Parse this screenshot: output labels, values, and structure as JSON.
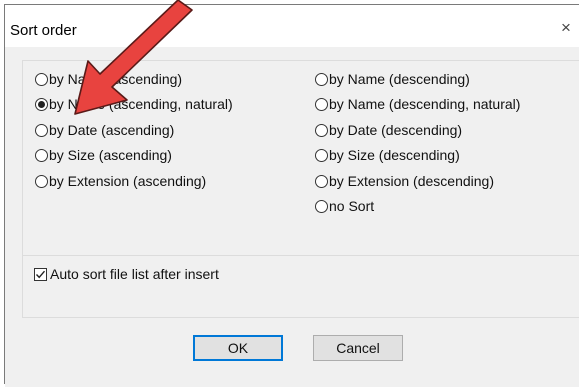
{
  "window": {
    "title": "Sort order",
    "close_glyph": "×"
  },
  "sort_options": {
    "left": [
      {
        "label": "by Name (ascending)",
        "checked": false
      },
      {
        "label": "by Name (ascending, natural)",
        "checked": true
      },
      {
        "label": "by Date (ascending)",
        "checked": false
      },
      {
        "label": "by Size (ascending)",
        "checked": false
      },
      {
        "label": "by Extension (ascending)",
        "checked": false
      }
    ],
    "right": [
      {
        "label": "by Name (descending)",
        "checked": false
      },
      {
        "label": "by Name (descending, natural)",
        "checked": false
      },
      {
        "label": "by Date (descending)",
        "checked": false
      },
      {
        "label": "by Size (descending)",
        "checked": false
      },
      {
        "label": "by Extension (descending)",
        "checked": false
      },
      {
        "label": "no Sort",
        "checked": false
      }
    ]
  },
  "auto_sort": {
    "label": "Auto sort file list after insert",
    "checked": true
  },
  "buttons": {
    "ok_label": "OK",
    "cancel_label": "Cancel"
  },
  "annotation": {
    "arrow_color": "#e8433f"
  }
}
